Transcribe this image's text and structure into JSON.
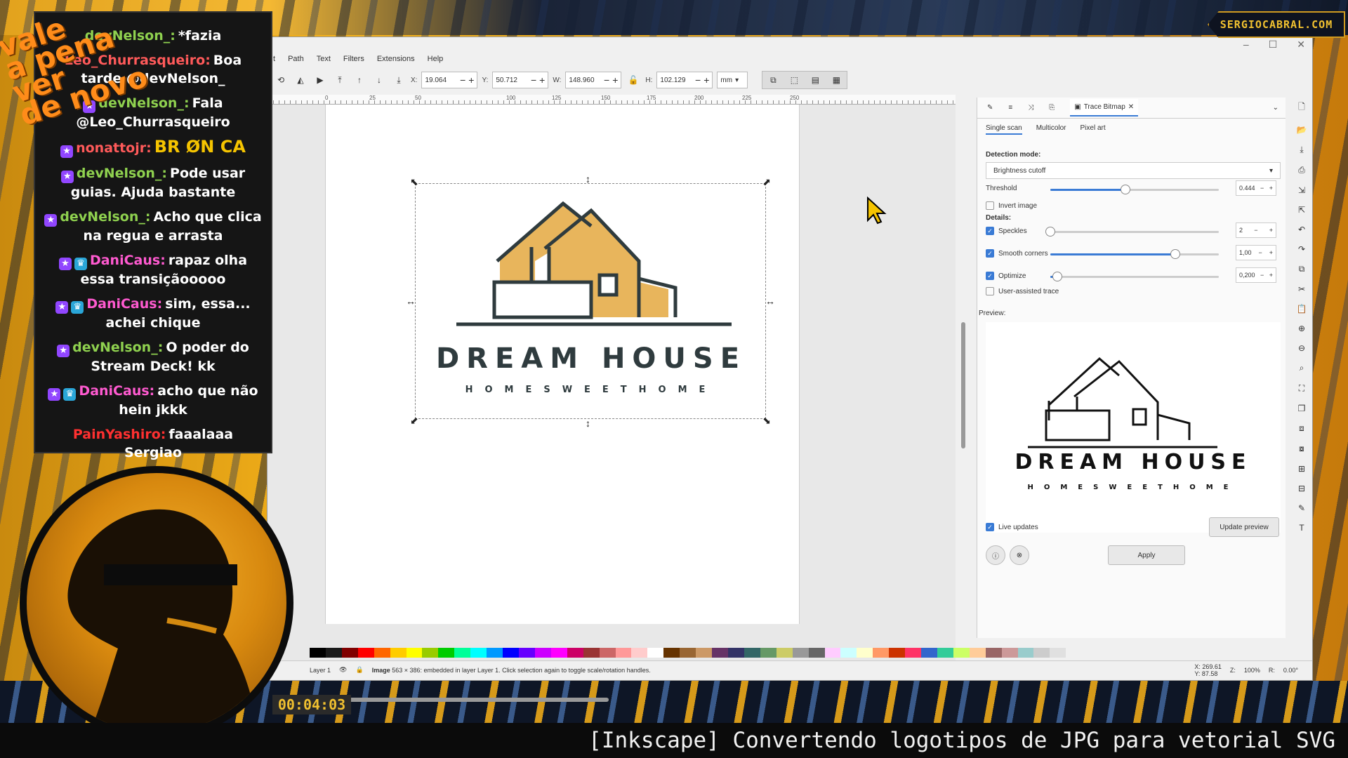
{
  "overlay": {
    "brand": "SERGIOCABRAL.COM",
    "vale_logo": [
      "vale",
      "a pena",
      "ver",
      "de novo"
    ],
    "timer": "00:04:03",
    "caption": "[Inkscape] Convertendo logotipos de JPG para vetorial SVG"
  },
  "chat": [
    {
      "user": "devNelson_:",
      "user_color": "#8fd14f",
      "badges": [],
      "text": "*fazia"
    },
    {
      "user": "Leo_Churrasqueiro:",
      "user_color": "#ff5a5a",
      "badges": [],
      "text": "Boa tarde @devNelson_"
    },
    {
      "user": "devNelson_:",
      "user_color": "#8fd14f",
      "badges": [
        "star"
      ],
      "text": "Fala @Leo_Churrasqueiro"
    },
    {
      "user": "nonattojr:",
      "user_color": "#ff5a5a",
      "badges": [
        "star"
      ],
      "text": "BR ØN CA"
    },
    {
      "user": "devNelson_:",
      "user_color": "#8fd14f",
      "badges": [
        "star"
      ],
      "text": "Pode usar guias. Ajuda bastante"
    },
    {
      "user": "devNelson_:",
      "user_color": "#8fd14f",
      "badges": [
        "star"
      ],
      "text": "Acho que clica na regua e arrasta"
    },
    {
      "user": "DaniCaus:",
      "user_color": "#ff5ad0",
      "badges": [
        "star",
        "crown"
      ],
      "text": "rapaz olha essa transiçãooooo"
    },
    {
      "user": "DaniCaus:",
      "user_color": "#ff5ad0",
      "badges": [
        "star",
        "crown"
      ],
      "text": "sim, essa... achei chique"
    },
    {
      "user": "devNelson_:",
      "user_color": "#8fd14f",
      "badges": [
        "star"
      ],
      "text": "O poder do Stream Deck! kk"
    },
    {
      "user": "DaniCaus:",
      "user_color": "#ff5ad0",
      "badges": [
        "star",
        "crown"
      ],
      "text": "acho que não hein jkkk"
    },
    {
      "user": "PainYashiro:",
      "user_color": "#ff3030",
      "badges": [],
      "text": "faaalaaa Sergiao"
    }
  ],
  "menu": [
    "t",
    "Path",
    "Text",
    "Filters",
    "Extensions",
    "Help"
  ],
  "toolbar": {
    "x_label": "X:",
    "x_value": "19.064",
    "y_label": "Y:",
    "y_value": "50.712",
    "w_label": "W:",
    "w_value": "148.960",
    "h_label": "H:",
    "h_value": "102.129",
    "unit": "mm"
  },
  "ruler_ticks": [
    "0",
    "25",
    "50",
    "100",
    "125",
    "150",
    "175",
    "200",
    "225",
    "250"
  ],
  "logo": {
    "title": "DREAM HOUSE",
    "subtitle": "HOMESWEETHOME",
    "accent": "#e8b55c",
    "ink": "#2f3b3e"
  },
  "palette": [
    "#000000",
    "#1a1a1a",
    "#800000",
    "#ff0000",
    "#ff6600",
    "#ffcc00",
    "#ffff00",
    "#99cc00",
    "#00cc00",
    "#00ff99",
    "#00ffff",
    "#0099ff",
    "#0000ff",
    "#6600ff",
    "#cc00ff",
    "#ff00ff",
    "#cc0066",
    "#993333",
    "#cc6666",
    "#ff9999",
    "#ffcccc",
    "#ffffff",
    "#663300",
    "#996633",
    "#cc9966",
    "#663366",
    "#333366",
    "#336666",
    "#669966",
    "#cccc66",
    "#999999",
    "#666666",
    "#ffccff",
    "#ccffff",
    "#ffffcc",
    "#ff9966",
    "#cc3300",
    "#ff3366",
    "#3366cc",
    "#33cc99",
    "#ccff66",
    "#ffcc99",
    "#996666",
    "#cc9999",
    "#99cccc",
    "#cccccc",
    "#e0e0e0",
    "#f0f0f0"
  ],
  "status": {
    "layer": "Layer 1",
    "message_bold": "Image",
    "message": "563 × 386: embedded in layer Layer 1. Click selection again to toggle scale/rotation handles.",
    "x_coord": "X: 269.61",
    "y_coord": "Y: 87.58",
    "zoom_label": "Z:",
    "zoom": "100%",
    "rotate_label": "R:",
    "rotate": "0.00°"
  },
  "dock": {
    "active_tab": "Trace Bitmap",
    "subtabs": [
      "Single scan",
      "Multicolor",
      "Pixel art"
    ],
    "detection_label": "Detection mode:",
    "detection_value": "Brightness cutoff",
    "threshold_label": "Threshold",
    "threshold_value": "0.444",
    "threshold_fraction": 0.444,
    "invert_label": "Invert image",
    "details_label": "Details:",
    "speckles_label": "Speckles",
    "speckles_value": "2",
    "speckles_fraction": 0.0,
    "smooth_label": "Smooth corners",
    "smooth_value": "1,00",
    "smooth_fraction": 0.74,
    "optimize_label": "Optimize",
    "optimize_value": "0,200",
    "optimize_fraction": 0.04,
    "user_assisted_label": "User-assisted trace",
    "preview_label": "Preview:",
    "preview_title": "DREAM HOUSE",
    "preview_subtitle": "HOMESWEETHOME",
    "live_updates_label": "Live updates",
    "update_preview_label": "Update preview",
    "apply_label": "Apply"
  }
}
